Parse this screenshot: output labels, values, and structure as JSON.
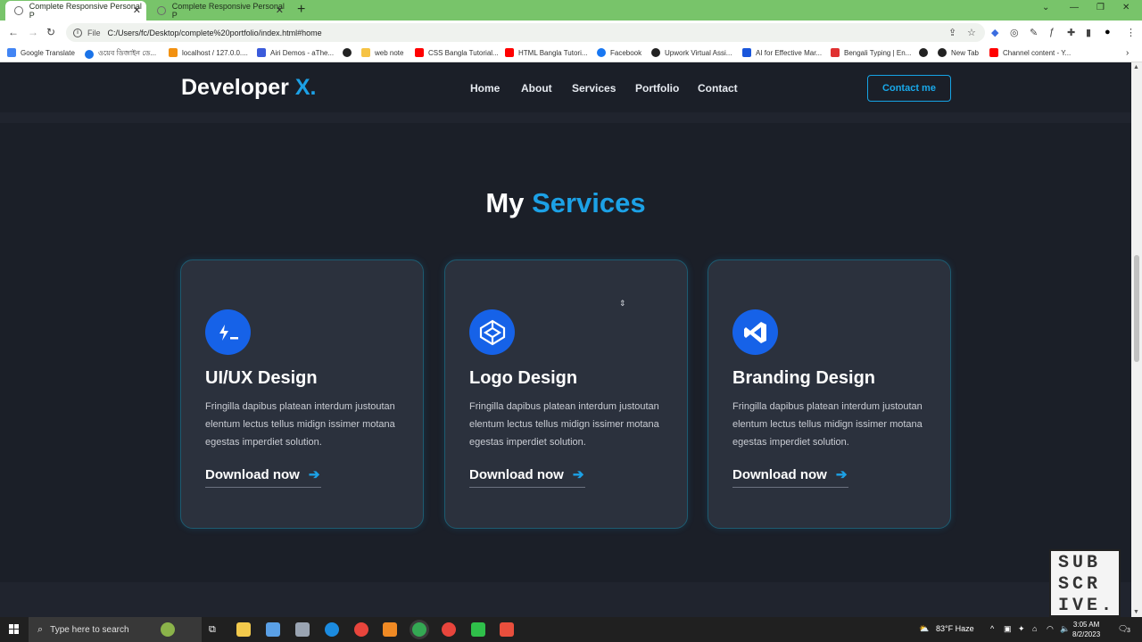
{
  "browser": {
    "tabs": [
      {
        "title": "Complete Responsive Personal P"
      },
      {
        "title": "Complete Responsive Personal P"
      }
    ],
    "new_tab": "+",
    "url_scheme": "File",
    "url": "C:/Users/fc/Desktop/complete%20portfolio/index.html#home",
    "bookmarks": [
      {
        "label": "Google Translate",
        "color": "#4285f4"
      },
      {
        "label": "ওয়েব ডিজাইন ডে...",
        "color": "#1a73e8"
      },
      {
        "label": "localhost / 127.0.0....",
        "color": "#f29111"
      },
      {
        "label": "Airi Demos - aThe...",
        "color": "#3b5bdb"
      },
      {
        "label": "",
        "color": "#222222"
      },
      {
        "label": "web note",
        "color": "#f6c344"
      },
      {
        "label": "CSS Bangla Tutorial...",
        "color": "#ff0000"
      },
      {
        "label": "HTML Bangla Tutori...",
        "color": "#ff0000"
      },
      {
        "label": "Facebook",
        "color": "#1877f2"
      },
      {
        "label": "Upwork Virtual Assi...",
        "color": "#222222"
      },
      {
        "label": "AI for Effective Mar...",
        "color": "#1a56db"
      },
      {
        "label": "Bengali Typing | En...",
        "color": "#e03131"
      },
      {
        "label": "",
        "color": "#222222"
      },
      {
        "label": "New Tab",
        "color": "#222222"
      },
      {
        "label": "Channel content - Y...",
        "color": "#ff0000"
      }
    ]
  },
  "site": {
    "logo_main": "Developer",
    "logo_accent": "X.",
    "nav": [
      "Home",
      "About",
      "Services",
      "Portfolio",
      "Contact"
    ],
    "contact_button": "Contact me",
    "section_title_main": "My",
    "section_title_accent": "Services",
    "cards": [
      {
        "icon": "terminal-icon",
        "title": "UI/UX Design",
        "text": "Fringilla dapibus platean interdum justoutan elentum lectus tellus midign issimer motana egestas imperdiet solution.",
        "link": "Download now"
      },
      {
        "icon": "codepen-icon",
        "title": "Logo Design",
        "text": "Fringilla dapibus platean interdum justoutan elentum lectus tellus midign issimer motana egestas imperdiet solution.",
        "link": "Download now"
      },
      {
        "icon": "vscode-icon",
        "title": "Branding Design",
        "text": "Fringilla dapibus platean interdum justoutan elentum lectus tellus midign issimer motana egestas imperdiet solution.",
        "link": "Download now"
      }
    ],
    "accent_color": "#1ca1e6"
  },
  "overlay": {
    "subscribe": [
      "SUB",
      "SCR",
      "IVE."
    ]
  },
  "taskbar": {
    "search_placeholder": "Type here to search",
    "weather": "83°F  Haze",
    "time": "3:05 AM",
    "date": "8/2/2023",
    "notifications": "3"
  }
}
